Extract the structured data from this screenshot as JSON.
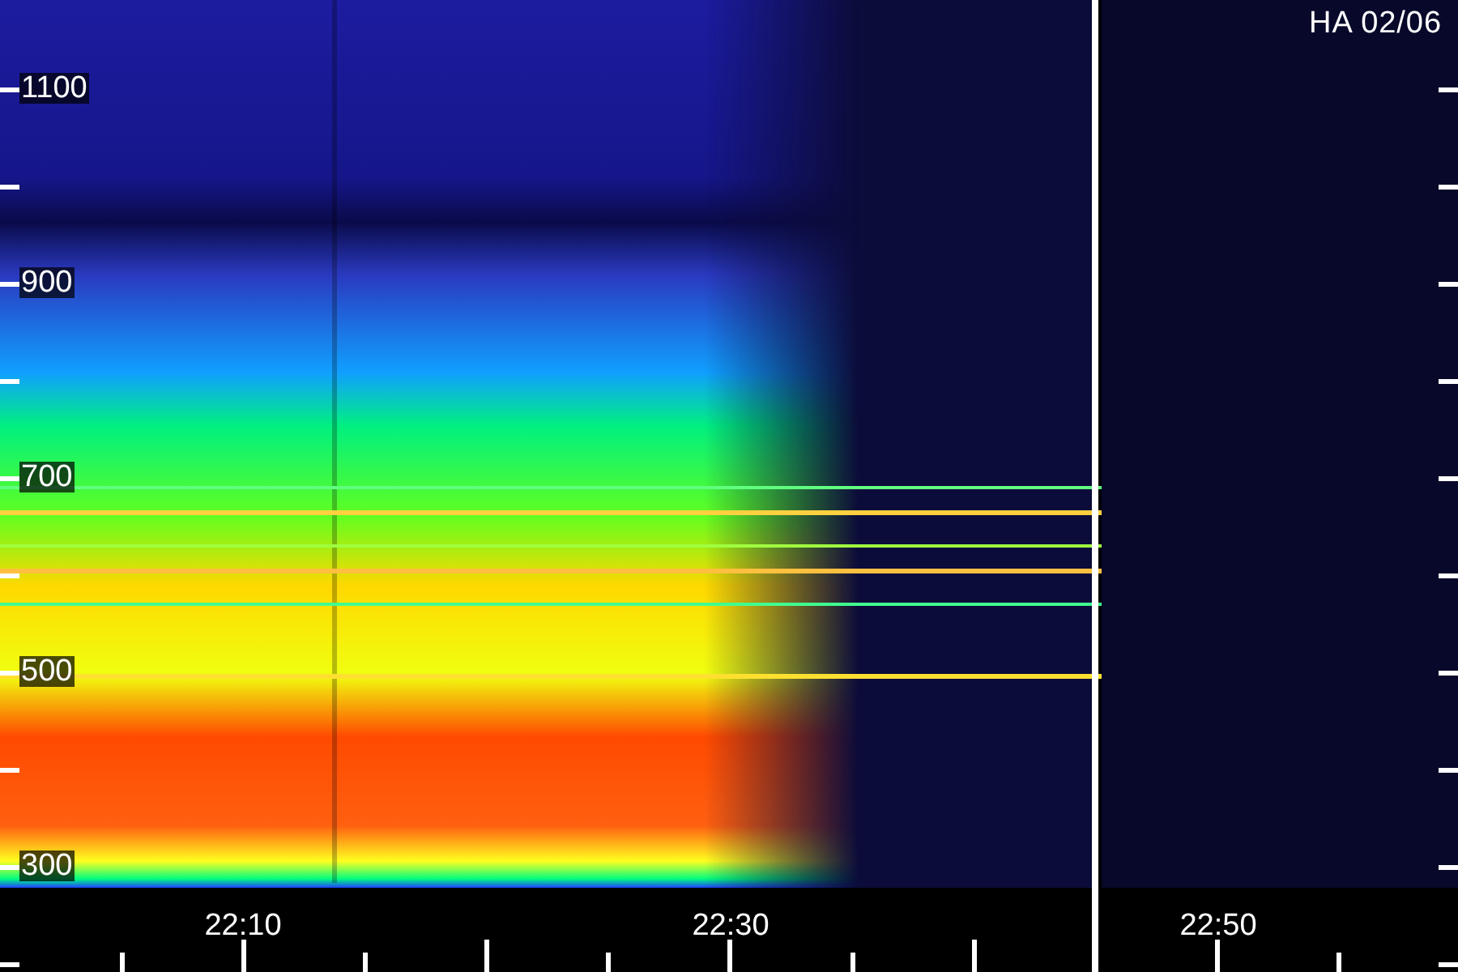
{
  "spectrogram": {
    "title": "HA 02/06",
    "y_labels": [
      "1100",
      "900",
      "700",
      "500",
      "300"
    ],
    "x_labels": [
      "22:10",
      "22:30",
      "22:50"
    ]
  }
}
